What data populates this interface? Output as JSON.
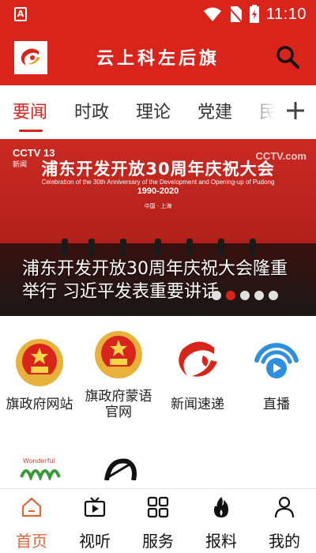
{
  "status_bar": {
    "app_badge": "A",
    "time": "11:10"
  },
  "header": {
    "title": "云上科左后旗",
    "icons": [
      "app-logo-icon",
      "search-icon"
    ]
  },
  "tabs": [
    {
      "label": "要闻",
      "active": true
    },
    {
      "label": "时政",
      "active": false
    },
    {
      "label": "理论",
      "active": false
    },
    {
      "label": "党建",
      "active": false
    },
    {
      "label": "民",
      "active": false
    }
  ],
  "banner": {
    "channel": "CCTV 13",
    "channel_sub": "新闻",
    "watermark": "CCTV.com",
    "headline": "浦东开发开放30周年庆祝大会",
    "headline_en_1": "Celebration of the 30th Anniversary of the Development and Opening-up of Pudong",
    "years": "1990-2020",
    "place": "中国 · 上海",
    "caption": "浦东开发开放30周年庆祝大会隆重举行 习近平发表重要讲话",
    "slides": 5,
    "active_slide": 1
  },
  "services": [
    {
      "label": "旗政府网站",
      "icon": "national-emblem-icon"
    },
    {
      "label": "旗政府蒙语官网",
      "icon": "national-emblem-icon"
    },
    {
      "label": "新闻速递",
      "icon": "app-logo-icon"
    },
    {
      "label": "直播",
      "icon": "live-broadcast-icon"
    },
    {
      "label": "",
      "icon": "wonderful-logo-icon"
    },
    {
      "label": "",
      "icon": "calligraphy-icon"
    }
  ],
  "bottom_nav": [
    {
      "label": "首页",
      "icon": "home-icon",
      "active": true
    },
    {
      "label": "视听",
      "icon": "video-icon",
      "active": false
    },
    {
      "label": "服务",
      "icon": "grid-icon",
      "active": false
    },
    {
      "label": "报料",
      "icon": "fire-icon",
      "active": false
    },
    {
      "label": "我的",
      "icon": "person-icon",
      "active": false
    }
  ],
  "colors": {
    "brand_red": "#d9241c",
    "nav_active": "#e0673a"
  }
}
